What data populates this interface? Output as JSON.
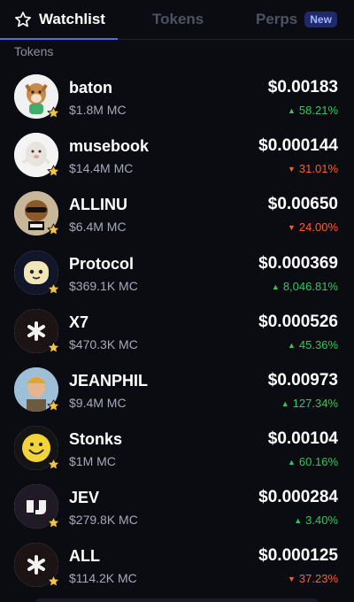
{
  "tabs": {
    "watchlist": "Watchlist",
    "tokens": "Tokens",
    "perps": "Perps",
    "perps_badge": "New"
  },
  "section_label": "Tokens",
  "colors": {
    "background": "#0b0b12",
    "accent": "#4a6cf7",
    "positive": "#34c759",
    "negative": "#ff5c33",
    "star": "#f5c242"
  },
  "tokens": [
    {
      "name": "baton",
      "mc": "$1.8M MC",
      "price": "$0.00183",
      "change": "58.21%",
      "direction": "up",
      "icon": "dog-avatar-icon"
    },
    {
      "name": "musebook",
      "mc": "$14.4M MC",
      "price": "$0.000144",
      "change": "31.01%",
      "direction": "down",
      "icon": "plush-creature-avatar-icon"
    },
    {
      "name": "ALLINU",
      "mc": "$6.4M MC",
      "price": "$0.00650",
      "change": "24.00%",
      "direction": "down",
      "icon": "dog-sunglasses-avatar-icon"
    },
    {
      "name": "Protocol",
      "mc": "$369.1K MC",
      "price": "$0.000369",
      "change": "8,046.81%",
      "direction": "up",
      "icon": "blob-face-avatar-icon"
    },
    {
      "name": "X7",
      "mc": "$470.3K MC",
      "price": "$0.000526",
      "change": "45.36%",
      "direction": "up",
      "icon": "asterisk-avatar-icon"
    },
    {
      "name": "JEANPHIL",
      "mc": "$9.4M MC",
      "price": "$0.00973",
      "change": "127.34%",
      "direction": "up",
      "icon": "cartoon-man-avatar-icon"
    },
    {
      "name": "Stonks",
      "mc": "$1M MC",
      "price": "$0.00104",
      "change": "60.16%",
      "direction": "up",
      "icon": "smiley-coin-avatar-icon"
    },
    {
      "name": "JEV",
      "mc": "$279.8K MC",
      "price": "$0.000284",
      "change": "3.40%",
      "direction": "up",
      "icon": "jev-logo-avatar-icon"
    },
    {
      "name": "ALL",
      "mc": "$114.2K MC",
      "price": "$0.000125",
      "change": "37.23%",
      "direction": "down",
      "icon": "asterisk-avatar-icon"
    }
  ]
}
